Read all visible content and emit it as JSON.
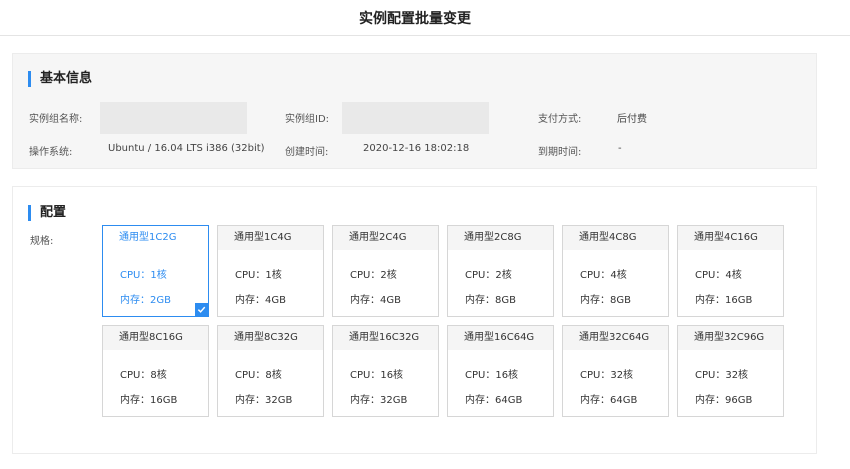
{
  "page": {
    "title": "实例配置批量变更"
  },
  "basic_info": {
    "section_title": "基本信息",
    "fields": {
      "instance_group_name": {
        "label": "实例组名称:",
        "value": ""
      },
      "instance_group_id": {
        "label": "实例组ID:",
        "value": ""
      },
      "payment": {
        "label": "支付方式:",
        "value": "后付费"
      },
      "os": {
        "label": "操作系统:",
        "value": "Ubuntu / 16.04 LTS i386 (32bit)"
      },
      "created": {
        "label": "创建时间:",
        "value": "2020-12-16 18:02:18"
      },
      "expire": {
        "label": "到期时间:",
        "value": "-"
      }
    }
  },
  "config": {
    "section_title": "配置",
    "spec_label": "规格:",
    "selected_index": 0,
    "specs": [
      {
        "name": "通用型1C2G",
        "cpu": "CPU：1核",
        "mem": "内存：2GB"
      },
      {
        "name": "通用型1C4G",
        "cpu": "CPU：1核",
        "mem": "内存：4GB"
      },
      {
        "name": "通用型2C4G",
        "cpu": "CPU：2核",
        "mem": "内存：4GB"
      },
      {
        "name": "通用型2C8G",
        "cpu": "CPU：2核",
        "mem": "内存：8GB"
      },
      {
        "name": "通用型4C8G",
        "cpu": "CPU：4核",
        "mem": "内存：8GB"
      },
      {
        "name": "通用型4C16G",
        "cpu": "CPU：4核",
        "mem": "内存：16GB"
      },
      {
        "name": "通用型8C16G",
        "cpu": "CPU：8核",
        "mem": "内存：16GB"
      },
      {
        "name": "通用型8C32G",
        "cpu": "CPU：8核",
        "mem": "内存：32GB"
      },
      {
        "name": "通用型16C32G",
        "cpu": "CPU：16核",
        "mem": "内存：32GB"
      },
      {
        "name": "通用型16C64G",
        "cpu": "CPU：16核",
        "mem": "内存：64GB"
      },
      {
        "name": "通用型32C64G",
        "cpu": "CPU：32核",
        "mem": "内存：64GB"
      },
      {
        "name": "通用型32C96G",
        "cpu": "CPU：32核",
        "mem": "内存：96GB"
      }
    ]
  },
  "colors": {
    "accent": "#2d8cf0",
    "panel_bg": "#f6f6f6",
    "card_border": "#d6d6d6"
  },
  "icons": {
    "selected_mark": "checkmark-icon"
  }
}
